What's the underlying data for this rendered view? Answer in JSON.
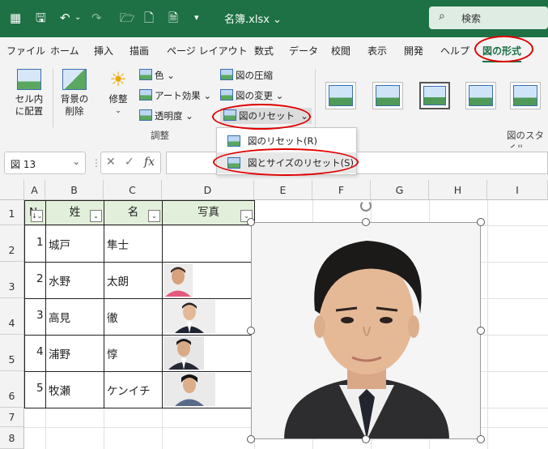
{
  "titlebar": {
    "filename": "名簿.xlsx",
    "search_label": "検索"
  },
  "tabs": [
    "ファイル",
    "ホーム",
    "挿入",
    "描画",
    "ページ レイアウト",
    "数式",
    "データ",
    "校閲",
    "表示",
    "開発",
    "ヘルプ",
    "図の形式"
  ],
  "ribbon": {
    "btn_crop_center": "セル内\nに配置",
    "btn_remove_bg": "背景の\n削除",
    "btn_corrections": "修整",
    "btn_color": "色",
    "btn_artistic": "アート効果",
    "btn_transparency": "透明度",
    "btn_compress": "図の圧縮",
    "btn_change": "図の変更",
    "btn_reset": "図のリセット",
    "group_adjust": "調整",
    "group_styles": "図のスタイル"
  },
  "menu": {
    "item_reset": "図のリセット(R)",
    "item_reset_size": "図とサイズのリセット(S)"
  },
  "namebox": "図 13",
  "fx": "fx",
  "columns": [
    "A",
    "B",
    "C",
    "D",
    "E",
    "F",
    "G",
    "H",
    "I"
  ],
  "rows": [
    "1",
    "2",
    "3",
    "4",
    "5",
    "6",
    "7",
    "8"
  ],
  "table": {
    "headers": [
      "N",
      "姓",
      "名",
      "写真"
    ],
    "rows": [
      {
        "no": "1",
        "sei": "城戸",
        "mei": "隼士"
      },
      {
        "no": "2",
        "sei": "水野",
        "mei": "太朗"
      },
      {
        "no": "3",
        "sei": "高見",
        "mei": "徹"
      },
      {
        "no": "4",
        "sei": "浦野",
        "mei": "惇"
      },
      {
        "no": "5",
        "sei": "牧瀬",
        "mei": "ケンイチ"
      }
    ]
  },
  "colors": {
    "title_green": "#1e7145",
    "header_fill": "#e2efda",
    "highlight_red": "#e00000"
  }
}
